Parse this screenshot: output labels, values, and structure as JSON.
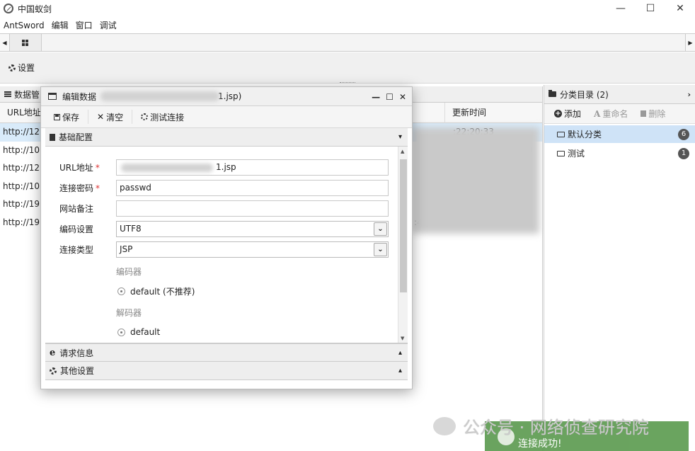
{
  "window": {
    "title": "中国蚁剑",
    "minimize": "—",
    "maximize": "☐",
    "close": "✕"
  },
  "menu": [
    "AntSword",
    "编辑",
    "窗口",
    "调试"
  ],
  "toolbar": {
    "settings_label": "设置"
  },
  "data_panel": {
    "title": "数据管",
    "columns": [
      "URL地址",
      "更新时间"
    ],
    "rows": [
      {
        "url": "http://12",
        "time": ":22:20:33"
      },
      {
        "url": "http://10",
        "time": "9"
      },
      {
        "url": "http://12",
        "time": ""
      },
      {
        "url": "http://10",
        "time": ""
      },
      {
        "url": "http://19",
        "time": ""
      },
      {
        "url": "http://19",
        "time": ":4"
      }
    ]
  },
  "category_panel": {
    "title": "分类目录 (2)",
    "tools": {
      "add": "添加",
      "rename": "重命名",
      "delete": "删除"
    },
    "items": [
      {
        "label": "默认分类",
        "count": "6"
      },
      {
        "label": "测试",
        "count": "1"
      }
    ]
  },
  "dialog": {
    "title": "编辑数据",
    "title_suffix": "1.jsp)",
    "tools": {
      "save": "保存",
      "clear": "清空",
      "test": "测试连接"
    },
    "sections": {
      "basic": "基础配置",
      "request": "请求信息",
      "other": "其他设置"
    },
    "form": {
      "url_label": "URL地址",
      "url_value": "1.jsp",
      "password_label": "连接密码",
      "password_value": "passwd",
      "note_label": "网站备注",
      "note_value": "",
      "encoding_label": "编码设置",
      "encoding_value": "UTF8",
      "type_label": "连接类型",
      "type_value": "JSP",
      "encoder_label": "编码器",
      "encoder_option": "default (不推荐)",
      "decoder_label": "解码器",
      "decoder_option": "default"
    }
  },
  "watermark": "公众号 · 网络侦查研究院",
  "toast": {
    "message": "连接成功!"
  },
  "colors": {
    "selected_row": "#d9ebfa",
    "selected_category": "#cfe3f7",
    "toast_green": "#5a9a4e",
    "required_star": "#d33333"
  }
}
